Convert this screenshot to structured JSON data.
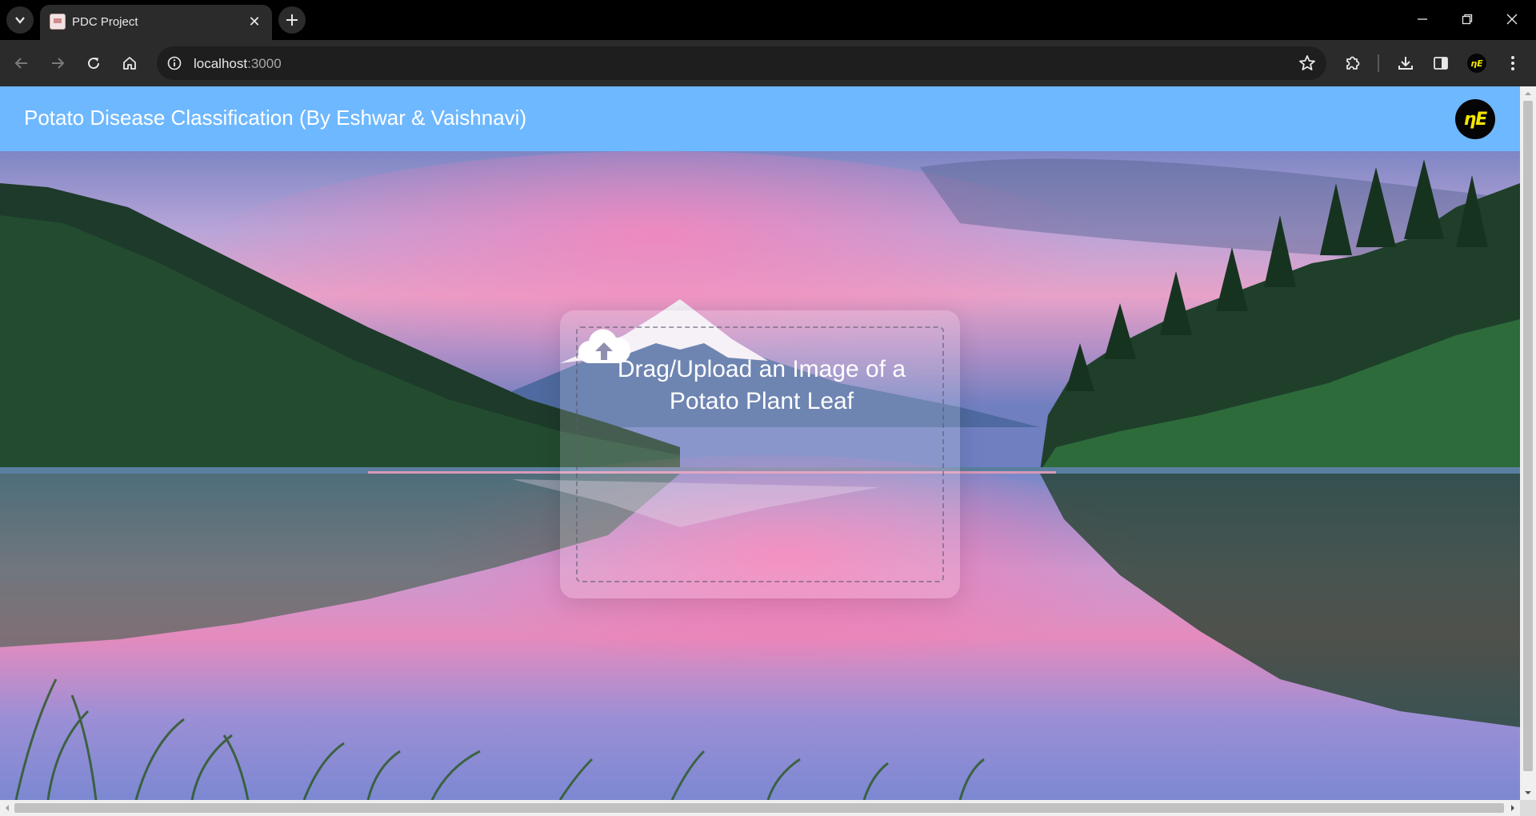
{
  "browser": {
    "tab": {
      "title": "PDC Project",
      "close_glyph": "✕",
      "favicon": "page-favicon"
    },
    "address": {
      "host": "localhost",
      "port": ":3000"
    },
    "icons": [
      "tab-search-icon",
      "new-tab-icon",
      "minimize-icon",
      "restore-icon",
      "close-window-icon",
      "back-icon",
      "forward-icon",
      "reload-icon",
      "home-icon",
      "site-info-icon",
      "bookmark-star-icon",
      "extensions-icon",
      "downloads-icon",
      "side-panel-icon",
      "profile-avatar-icon",
      "menu-kebab-icon"
    ],
    "profile_initials": "ƞE"
  },
  "page": {
    "header": {
      "title": "Potato Disease Classification (By Eshwar & Vaishnavi)",
      "logo_text": "ƞE"
    },
    "dropzone": {
      "prompt": "Drag/Upload an Image of a Potato Plant Leaf",
      "icon": "cloud-upload-icon"
    },
    "background": "mountain-lake-sunset-photo"
  },
  "colors": {
    "navbar": "#6eb8ff",
    "logo_accent": "#f3e600",
    "chrome_dark": "#2b2b2b"
  }
}
